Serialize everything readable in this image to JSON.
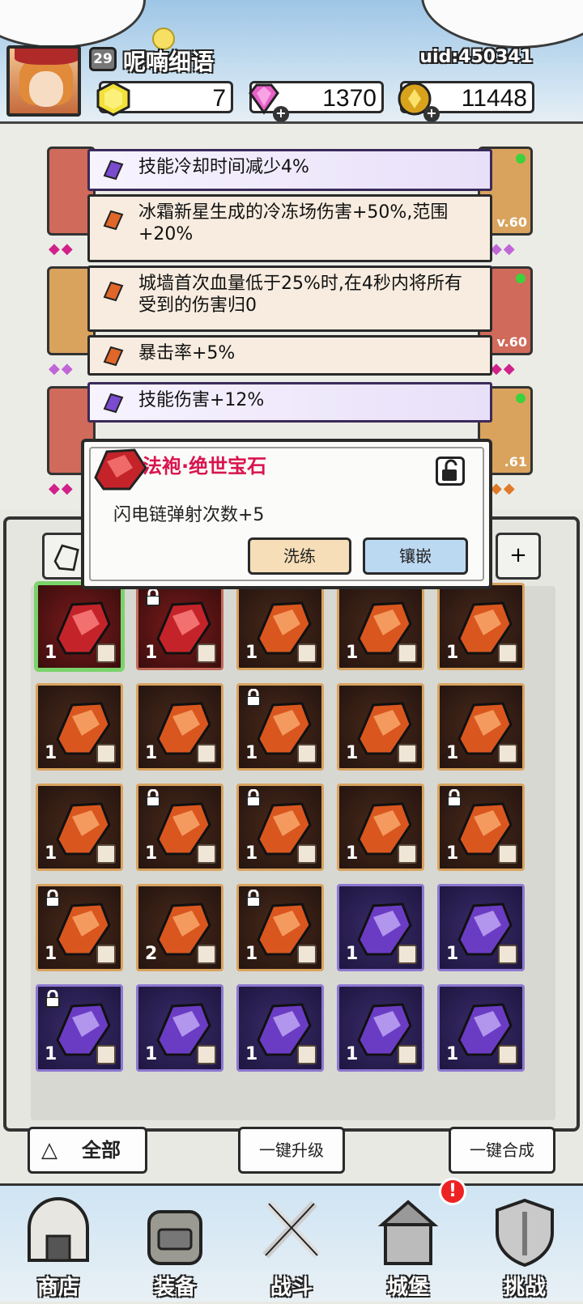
{
  "player": {
    "level": "29",
    "name": "呢喃细语",
    "uid": "uid:450341"
  },
  "currencies": [
    {
      "icon": "yellow-gem-icon",
      "value": "7"
    },
    {
      "icon": "pink-diamond-icon",
      "value": "1370"
    },
    {
      "icon": "gold-coin-icon",
      "value": "11448"
    }
  ],
  "equipment_levels": [
    "v.60",
    "v.60",
    ".61"
  ],
  "skills": [
    {
      "text": "技能冷却时间减少4%",
      "gem": "purple"
    },
    {
      "text": "冰霜新星生成的冷冻场伤害+50%,范围+20%",
      "gem": "orange"
    },
    {
      "text": "城墙首次血量低于25%时,在4秒内将所有受到的伤害归0",
      "gem": "orange"
    },
    {
      "text": "暴击率+5%",
      "gem": "orange"
    },
    {
      "text": "技能伤害+12%",
      "gem": "purple"
    }
  ],
  "gem_popup": {
    "title": "法袍·绝世宝石",
    "description": "闪电链弹射次数+5",
    "refine_label": "洗练",
    "inlay_label": "镶嵌"
  },
  "inventory": [
    {
      "color": "red",
      "count": "1",
      "locked": false,
      "selected": true
    },
    {
      "color": "red",
      "count": "1",
      "locked": true,
      "selected": false
    },
    {
      "color": "orange",
      "count": "1",
      "locked": false,
      "selected": false
    },
    {
      "color": "orange",
      "count": "1",
      "locked": false,
      "selected": false
    },
    {
      "color": "orange",
      "count": "1",
      "locked": false,
      "selected": false
    },
    {
      "color": "orange",
      "count": "1",
      "locked": false,
      "selected": false
    },
    {
      "color": "orange",
      "count": "1",
      "locked": false,
      "selected": false
    },
    {
      "color": "orange",
      "count": "1",
      "locked": true,
      "selected": false
    },
    {
      "color": "orange",
      "count": "1",
      "locked": false,
      "selected": false
    },
    {
      "color": "orange",
      "count": "1",
      "locked": false,
      "selected": false
    },
    {
      "color": "orange",
      "count": "1",
      "locked": false,
      "selected": false
    },
    {
      "color": "orange",
      "count": "1",
      "locked": true,
      "selected": false
    },
    {
      "color": "orange",
      "count": "1",
      "locked": true,
      "selected": false
    },
    {
      "color": "orange",
      "count": "1",
      "locked": false,
      "selected": false
    },
    {
      "color": "orange",
      "count": "1",
      "locked": true,
      "selected": false
    },
    {
      "color": "orange",
      "count": "1",
      "locked": true,
      "selected": false
    },
    {
      "color": "orange",
      "count": "2",
      "locked": false,
      "selected": false
    },
    {
      "color": "orange",
      "count": "1",
      "locked": true,
      "selected": false
    },
    {
      "color": "purple",
      "count": "1",
      "locked": false,
      "selected": false
    },
    {
      "color": "purple",
      "count": "1",
      "locked": false,
      "selected": false
    },
    {
      "color": "purple",
      "count": "1",
      "locked": true,
      "selected": false
    },
    {
      "color": "purple",
      "count": "1",
      "locked": false,
      "selected": false
    },
    {
      "color": "purple",
      "count": "1",
      "locked": false,
      "selected": false
    },
    {
      "color": "purple",
      "count": "1",
      "locked": false,
      "selected": false
    },
    {
      "color": "purple",
      "count": "1",
      "locked": false,
      "selected": false
    }
  ],
  "actions": {
    "filter_label": "全部",
    "upgrade_all_label": "一键升级",
    "merge_all_label": "一键合成"
  },
  "nav": {
    "shop": "商店",
    "equipment": "装备",
    "battle": "战斗",
    "castle": "城堡",
    "challenge": "挑战",
    "castle_badge": "!"
  }
}
